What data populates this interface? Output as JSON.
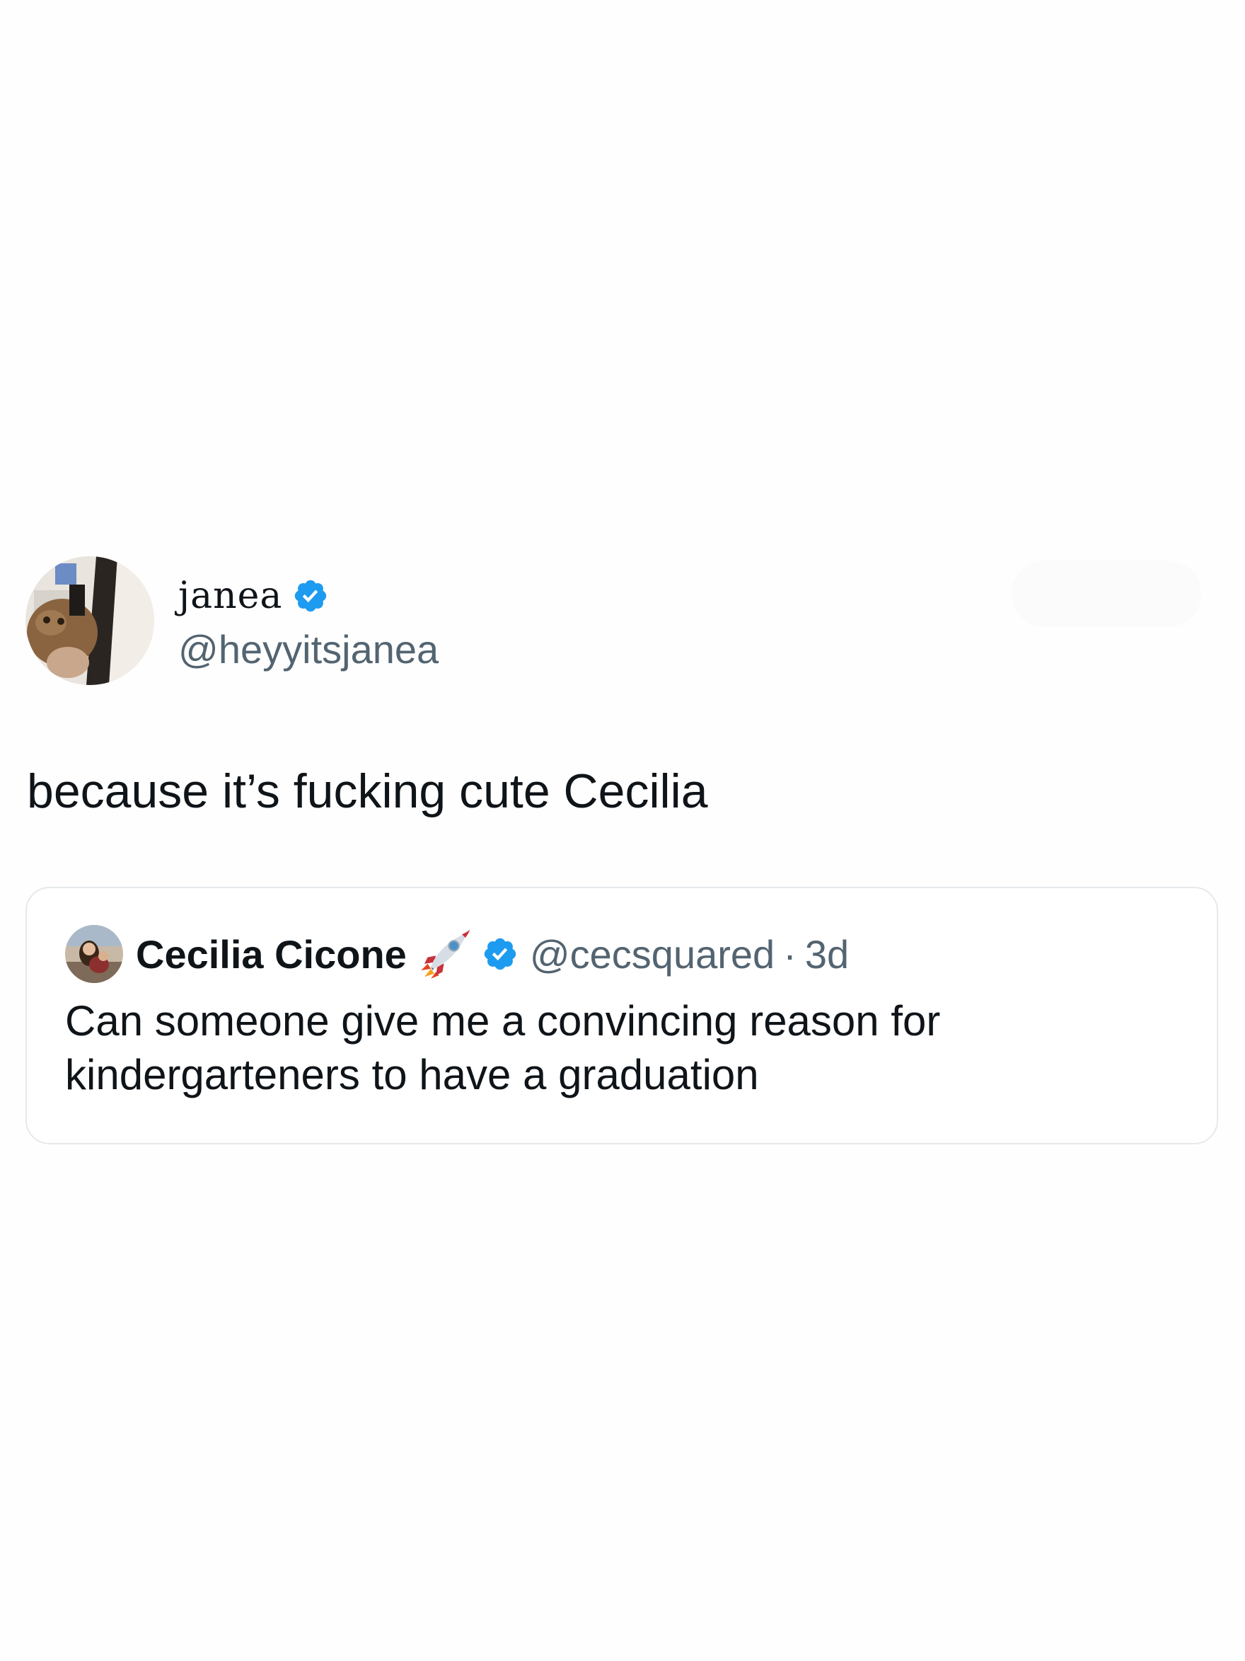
{
  "tweet": {
    "author": {
      "display_name": "janea",
      "handle": "@heyyitsjanea",
      "verified_icon": "verified-badge-icon",
      "avatar_icon": "profile-photo"
    },
    "text": "because it’s fucking cute Cecilia",
    "quoted_tweet": {
      "author": {
        "display_name": "Cecilia Cicone",
        "emoji": "rocket-emoji-icon",
        "verified_icon": "verified-badge-icon",
        "handle": "@cecsquared",
        "separator": "·",
        "time": "3d"
      },
      "text": "Can someone give me a convincing reason for kindergarteners to have a graduation"
    }
  },
  "colors": {
    "text_primary": "#0f1419",
    "text_secondary": "#536471",
    "verified_blue": "#1d9bf0",
    "card_border": "#e6e9ec",
    "background": "#fefefe"
  }
}
